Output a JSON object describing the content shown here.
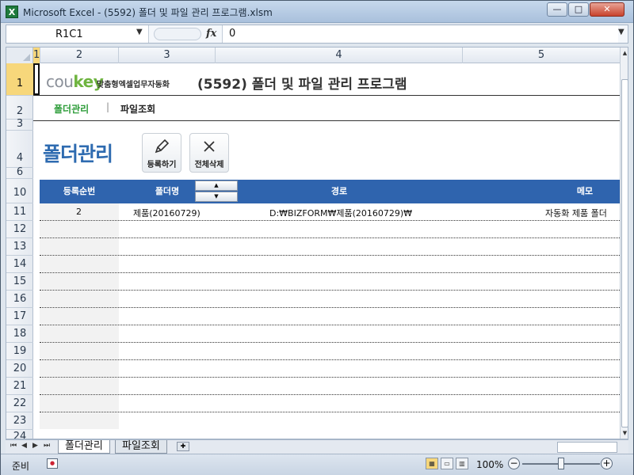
{
  "window": {
    "title": "Microsoft Excel - (5592) 폴더 및  파일 관리 프로그램.xlsm",
    "app_icon": "X",
    "minimize": "—",
    "maximize": "□",
    "close": "✕"
  },
  "formula_bar": {
    "name_box": "R1C1",
    "fx": "fx",
    "value": "0"
  },
  "columns": [
    "1",
    "2",
    "3",
    "4",
    "5"
  ],
  "rows": [
    "1",
    "2",
    "3",
    "4",
    "6",
    "10",
    "11",
    "12",
    "13",
    "14",
    "15",
    "16",
    "17",
    "18",
    "19",
    "20",
    "21",
    "22",
    "23",
    "24"
  ],
  "header": {
    "logo_cou": "cou",
    "logo_key": "key",
    "tagline": "맞춤형엑셀업무자동화",
    "title": "(5592) 폴더 및  파일 관리 프로그램"
  },
  "nav": {
    "folder": "폴더관리",
    "separator": "|",
    "file": "파일조회"
  },
  "section": {
    "title": "폴더관리",
    "register_label": "등록하기",
    "delete_all_label": "전체삭제"
  },
  "table": {
    "headers": [
      "등록순번",
      "폴더명",
      "경로",
      "메모"
    ],
    "rows": [
      {
        "num": "2",
        "name": "제품(20160729)",
        "path": "D:₩BIZFORM₩제품(20160729)₩",
        "memo": "자동화 제품 폴더"
      }
    ]
  },
  "sheet_tabs": [
    "폴더관리",
    "파일조회"
  ],
  "status": {
    "ready": "준비",
    "zoom": "100%"
  },
  "icons": {
    "register": "pencil-icon",
    "delete": "x-icon",
    "accent": "#2f64ae",
    "nav_active": "#2e9d3a"
  }
}
